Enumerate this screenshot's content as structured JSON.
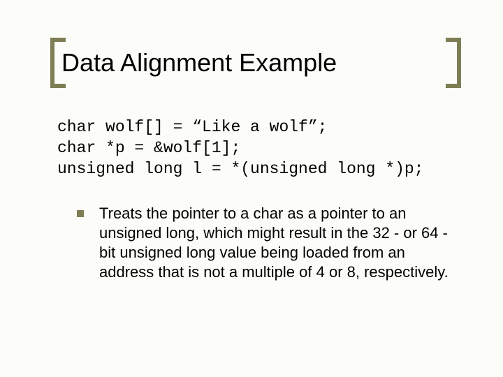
{
  "title": "Data Alignment Example",
  "code": {
    "line1": "char wolf[] = “Like a wolf”;",
    "line2": "char *p = &wolf[1];",
    "line3": "unsigned long l = *(unsigned long *)p;"
  },
  "bullet": "Treats the pointer to a char as a pointer to an unsigned long, which might result in the 32 - or 64 - bit unsigned long value being loaded from an address that is not a multiple of 4 or 8, respectively."
}
